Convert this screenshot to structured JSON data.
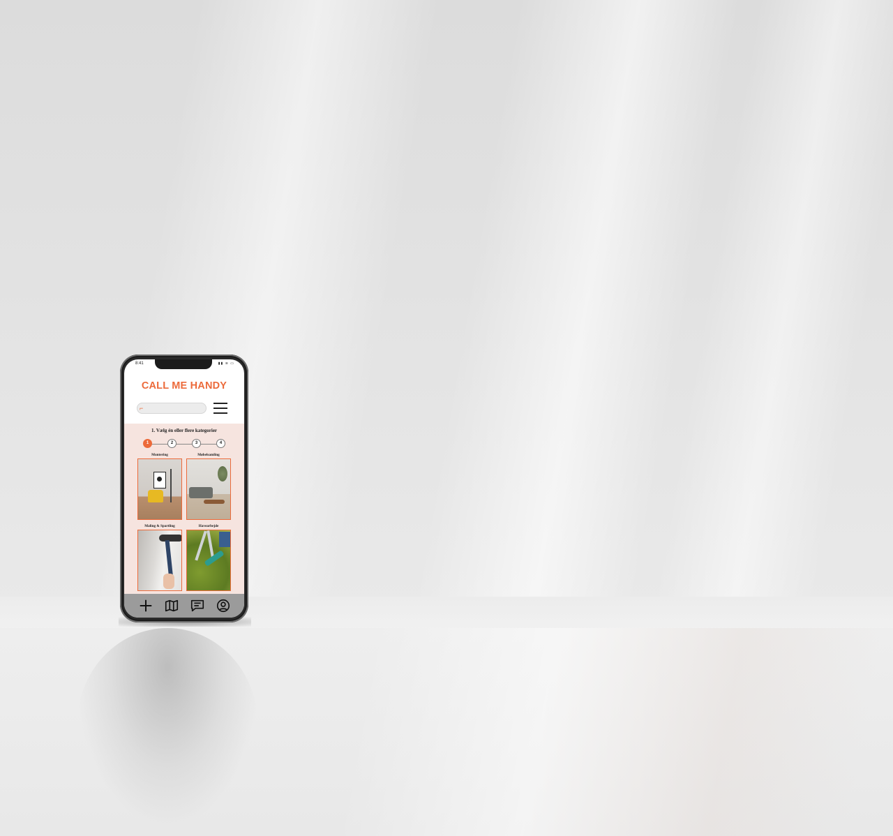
{
  "status_bar": {
    "time": "8:41",
    "indicators": "▮▮ ≋ ▭"
  },
  "app": {
    "title": "CALL ME HANDY",
    "brand_color": "#ec6a3a"
  },
  "search": {
    "icon": "paint-roller-icon",
    "placeholder": ""
  },
  "header": {
    "menu_icon": "hamburger-menu-icon"
  },
  "booking": {
    "step_title": "1. Vælg én eller flere kategorier",
    "steps": [
      {
        "label": "1",
        "active": true
      },
      {
        "label": "2",
        "active": false
      },
      {
        "label": "3",
        "active": false
      },
      {
        "label": "4",
        "active": false
      }
    ],
    "categories": [
      {
        "label": "Montering",
        "image": "living room with yellow armchair"
      },
      {
        "label": "Møbelsamling",
        "image": "living room with sofa and coffee table"
      },
      {
        "label": "Maling & Spartling",
        "image": "paint roller on wall"
      },
      {
        "label": "Havearbejde",
        "image": "garden shears trimming hedge"
      }
    ]
  },
  "tabbar": {
    "items": [
      {
        "icon": "plus-icon"
      },
      {
        "icon": "map-icon"
      },
      {
        "icon": "chat-icon"
      },
      {
        "icon": "profile-icon"
      }
    ]
  }
}
